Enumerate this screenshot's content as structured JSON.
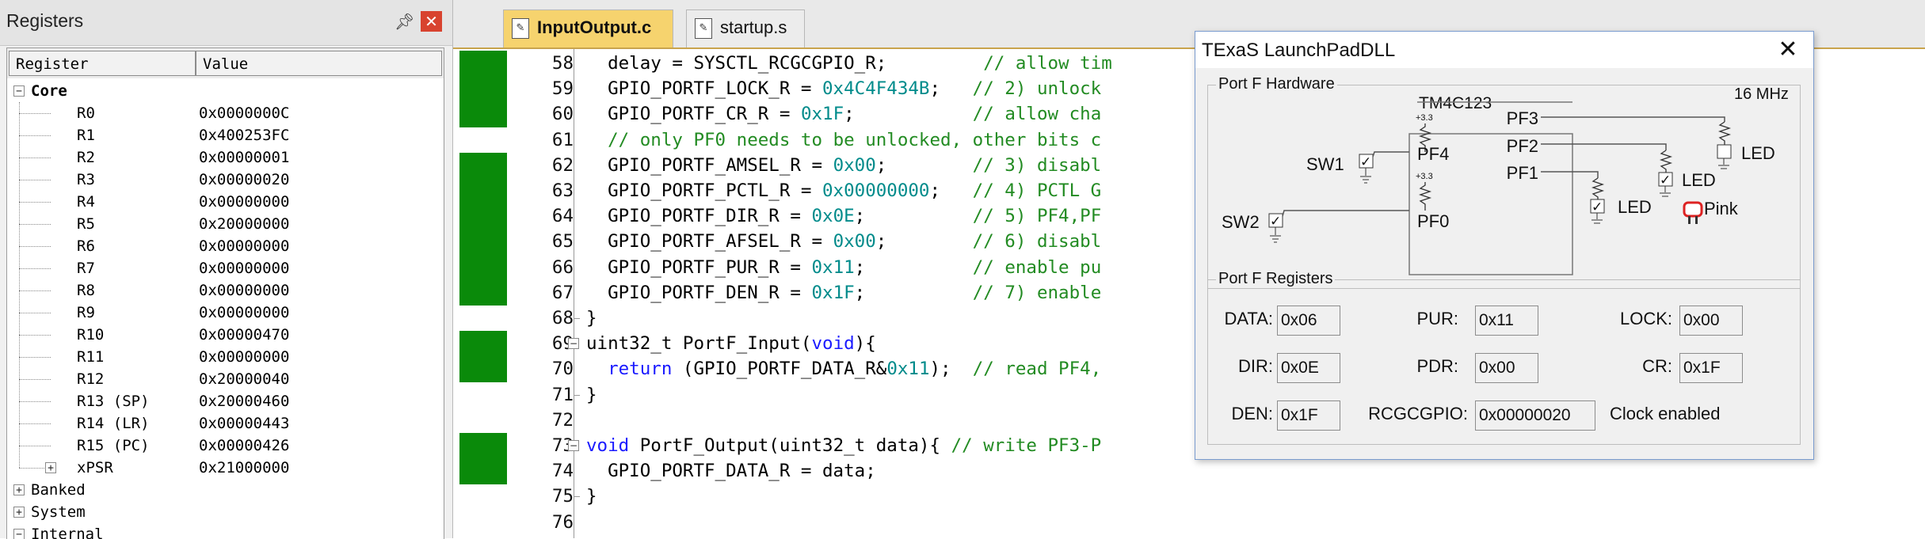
{
  "registers_panel": {
    "title": "Registers",
    "columns": {
      "register": "Register",
      "value": "Value"
    },
    "core_label": "Core",
    "core_registers": [
      {
        "name": "R0",
        "value": "0x0000000C"
      },
      {
        "name": "R1",
        "value": "0x400253FC"
      },
      {
        "name": "R2",
        "value": "0x00000001"
      },
      {
        "name": "R3",
        "value": "0x00000020"
      },
      {
        "name": "R4",
        "value": "0x00000000"
      },
      {
        "name": "R5",
        "value": "0x20000000"
      },
      {
        "name": "R6",
        "value": "0x00000000"
      },
      {
        "name": "R7",
        "value": "0x00000000"
      },
      {
        "name": "R8",
        "value": "0x00000000"
      },
      {
        "name": "R9",
        "value": "0x00000000"
      },
      {
        "name": "R10",
        "value": "0x00000470"
      },
      {
        "name": "R11",
        "value": "0x00000000"
      },
      {
        "name": "R12",
        "value": "0x20000040"
      },
      {
        "name": "R13 (SP)",
        "value": "0x20000460"
      },
      {
        "name": "R14 (LR)",
        "value": "0x00000443"
      },
      {
        "name": "R15 (PC)",
        "value": "0x00000426"
      },
      {
        "name": "xPSR",
        "value": "0x21000000"
      }
    ],
    "groups": [
      "Banked",
      "System",
      "Internal"
    ]
  },
  "editor": {
    "tabs": [
      {
        "label": "InputOutput.c",
        "active": true
      },
      {
        "label": "startup.s",
        "active": false
      }
    ],
    "lines": [
      {
        "n": "58",
        "text": "  delay = SYSCTL_RCGCGPIO_R;         // allow tim"
      },
      {
        "n": "59",
        "text": "  GPIO_PORTF_LOCK_R = 0x4C4F434B;   // 2) unlock"
      },
      {
        "n": "60",
        "text": "  GPIO_PORTF_CR_R = 0x1F;           // allow cha"
      },
      {
        "n": "61",
        "text": "  // only PF0 needs to be unlocked, other bits c"
      },
      {
        "n": "62",
        "text": "  GPIO_PORTF_AMSEL_R = 0x00;        // 3) disabl"
      },
      {
        "n": "63",
        "text": "  GPIO_PORTF_PCTL_R = 0x00000000;   // 4) PCTL G"
      },
      {
        "n": "64",
        "text": "  GPIO_PORTF_DIR_R = 0x0E;          // 5) PF4,PF"
      },
      {
        "n": "65",
        "text": "  GPIO_PORTF_AFSEL_R = 0x00;        // 6) disabl"
      },
      {
        "n": "66",
        "text": "  GPIO_PORTF_PUR_R = 0x11;          // enable pu"
      },
      {
        "n": "67",
        "text": "  GPIO_PORTF_DEN_R = 0x1F;          // 7) enable"
      },
      {
        "n": "68",
        "text": "}"
      },
      {
        "n": "69",
        "text": "uint32_t PortF_Input(void){"
      },
      {
        "n": "70",
        "text": "  return (GPIO_PORTF_DATA_R&0x11);  // read PF4,"
      },
      {
        "n": "71",
        "text": "}"
      },
      {
        "n": "72",
        "text": ""
      },
      {
        "n": "73",
        "text": "void PortF_Output(uint32_t data){ // write PF3-P"
      },
      {
        "n": "74",
        "text": "  GPIO_PORTF_DATA_R = data;"
      },
      {
        "n": "75",
        "text": "}"
      },
      {
        "n": "76",
        "text": ""
      }
    ]
  },
  "texas_dialog": {
    "title": "TExaS LaunchPadDLL",
    "hardware": {
      "group_label": "Port F Hardware",
      "chip": "TM4C123",
      "clock": "16 MHz",
      "sw1": "SW1",
      "sw2": "SW2",
      "pins_left": [
        "PF4",
        "PF0"
      ],
      "pins_right": [
        "PF3",
        "PF2",
        "PF1"
      ],
      "v33": "+3.3",
      "led": "LED",
      "led_color": "Pink",
      "sw1_checked": true,
      "sw2_checked": true,
      "led_checked": [
        false,
        true,
        true
      ]
    },
    "registers": {
      "group_label": "Port F Registers",
      "DATA": "0x06",
      "PUR": "0x11",
      "LOCK": "0x00",
      "DIR": "0x0E",
      "PDR": "0x00",
      "CR": "0x1F",
      "DEN": "0x1F",
      "RCGCGPIO": "0x00000020",
      "clock_status": "Clock enabled",
      "labels": {
        "DATA": "DATA:",
        "PUR": "PUR:",
        "LOCK": "LOCK:",
        "DIR": "DIR:",
        "PDR": "PDR:",
        "CR": "CR:",
        "DEN": "DEN:",
        "RCGCGPIO": "RCGCGPIO:"
      }
    }
  }
}
